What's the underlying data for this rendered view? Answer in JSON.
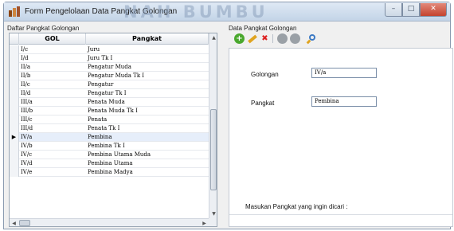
{
  "window": {
    "title": "Form Pengelolaan Data Pangkat Golongan",
    "watermark": "NAH BUMBU",
    "controls": {
      "minimize": "–",
      "maximize": "□",
      "close": "✕"
    }
  },
  "left_panel": {
    "group_label": "Daftar Pangkat Golongan",
    "columns": {
      "gol": "GOL",
      "pangkat": "Pangkat"
    },
    "current_marker": "▶",
    "current_row": 10,
    "rows": [
      {
        "gol": "I/c",
        "pangkat": "Juru"
      },
      {
        "gol": "I/d",
        "pangkat": "Juru Tk I"
      },
      {
        "gol": "II/a",
        "pangkat": "Pengatur Muda"
      },
      {
        "gol": "II/b",
        "pangkat": "Pengatur Muda Tk I"
      },
      {
        "gol": "II/c",
        "pangkat": "Pengatur"
      },
      {
        "gol": "II/d",
        "pangkat": "Pengatur Tk I"
      },
      {
        "gol": "III/a",
        "pangkat": "Penata Muda"
      },
      {
        "gol": "III/b",
        "pangkat": "Penata Muda Tk I"
      },
      {
        "gol": "III/c",
        "pangkat": "Penata"
      },
      {
        "gol": "III/d",
        "pangkat": "Penata Tk I"
      },
      {
        "gol": "IV/a",
        "pangkat": "Pembina"
      },
      {
        "gol": "IV/b",
        "pangkat": "Pembina Tk I"
      },
      {
        "gol": "IV/c",
        "pangkat": "Pembina Utama Muda"
      },
      {
        "gol": "IV/d",
        "pangkat": "Pembina Utama"
      },
      {
        "gol": "IV/e",
        "pangkat": "Pembina Madya"
      }
    ]
  },
  "right_panel": {
    "group_label": "Data Pangkat Golongan",
    "toolbar": {
      "add_icon": "add-icon",
      "edit_icon": "edit-icon",
      "delete_icon": "delete-icon",
      "save_icon": "save-icon",
      "cancel_icon": "cancel-icon",
      "search_icon": "search-icon",
      "add_glyph": "+",
      "delete_glyph": "✖"
    },
    "golongan_label": "Golongan",
    "golongan_value": "IV/a",
    "pangkat_label": "Pangkat",
    "pangkat_value": "Pembina",
    "search_label": "Masukan Pangkat yang ingin dicari :"
  },
  "colors": {
    "title_bar": "#c3d4e7",
    "selected_row": "#e6eefa",
    "add_green": "#4aa82e",
    "close_red": "#c4432e"
  }
}
